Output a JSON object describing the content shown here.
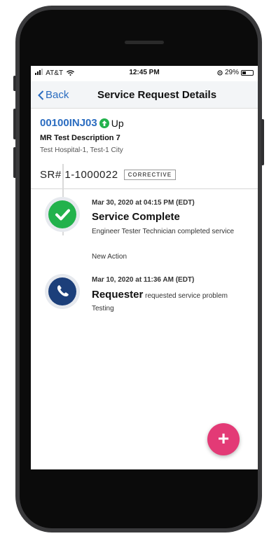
{
  "status_bar": {
    "carrier": "AT&T",
    "time": "12:45 PM",
    "battery": "29%"
  },
  "nav": {
    "back_label": "Back",
    "title": "Service Request Details"
  },
  "asset": {
    "id": "00100INJ03",
    "status": "Up",
    "description": "MR  Test Description 7",
    "location": "Test Hospital-1, Test-1 City"
  },
  "service_request": {
    "number": "SR# 1-1000022",
    "type_badge": "CORRECTIVE"
  },
  "timeline": [
    {
      "date": "Mar 30, 2020 at 04:15 PM (EDT)",
      "title": "Service Complete",
      "text": "Engineer Tester Technician  completed service",
      "extra": "New Action",
      "icon": "check-icon",
      "color": "#22b24c"
    },
    {
      "date": "Mar 10, 2020 at 11:36 AM (EDT)",
      "title": "Requester",
      "text": "requested service problem Testing",
      "icon": "phone-icon",
      "color": "#1c3f7a"
    }
  ],
  "fab": {
    "label": "+",
    "icon": "plus-icon",
    "color": "#e33a76"
  }
}
